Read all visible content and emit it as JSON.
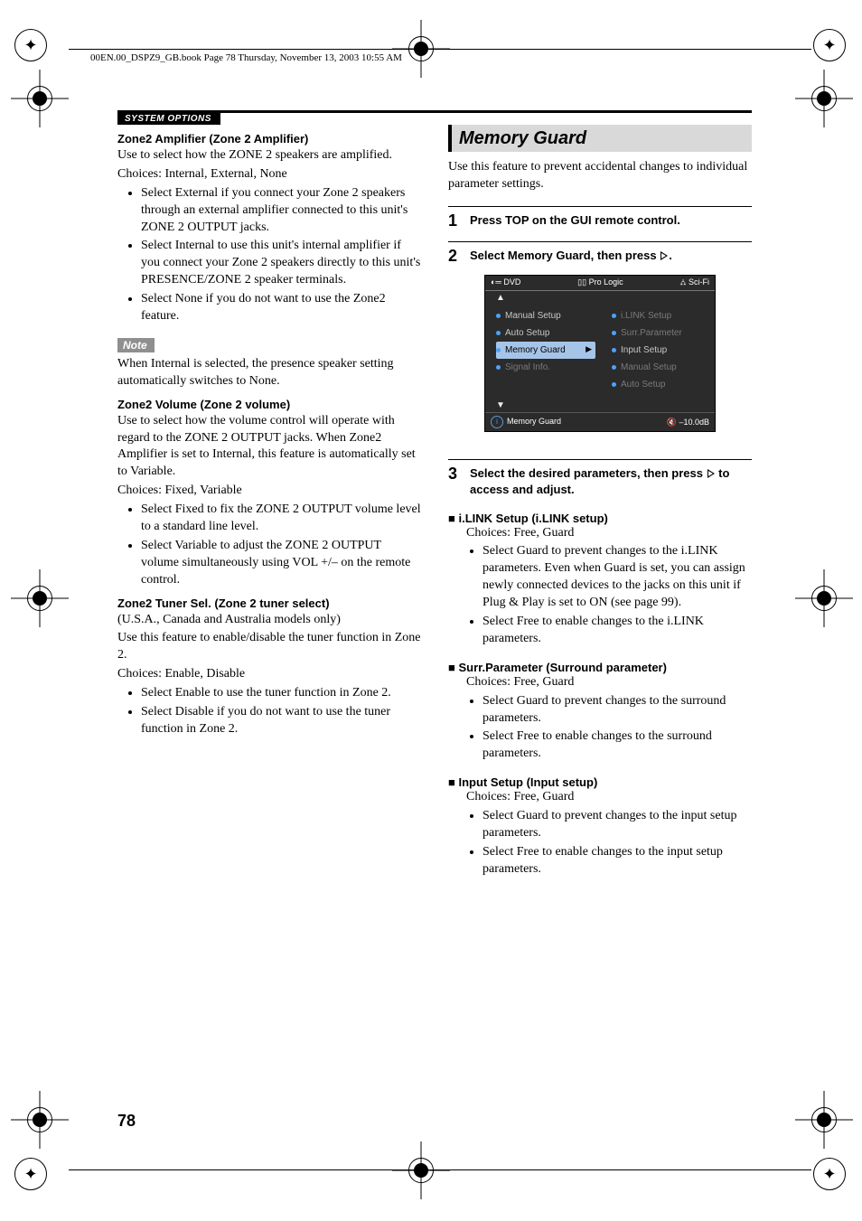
{
  "header_line": "00EN.00_DSPZ9_GB.book  Page 78  Thursday, November 13, 2003  10:55 AM",
  "section_label": "SYSTEM OPTIONS",
  "page_number": "78",
  "left": {
    "zone2amp": {
      "heading": "Zone2 Amplifier (Zone 2 Amplifier)",
      "p1": "Use to select how the ZONE 2 speakers are amplified.",
      "p2": "Choices: Internal, External, None",
      "b1": "Select External if you connect your Zone 2 speakers through an external amplifier connected to this unit's ZONE 2 OUTPUT jacks.",
      "b2": "Select Internal to use this unit's internal amplifier if you connect your Zone 2 speakers directly to this unit's PRESENCE/ZONE 2 speaker terminals.",
      "b3": "Select None if you do not want to use the Zone2 feature."
    },
    "note_label": "Note",
    "note_text": "When Internal is selected, the presence speaker setting automatically switches to None.",
    "zone2vol": {
      "heading": "Zone2 Volume (Zone 2 volume)",
      "p1": "Use to select how the volume control will operate with regard to the ZONE 2 OUTPUT jacks. When Zone2 Amplifier is set to Internal, this feature is automatically set to Variable.",
      "p2": "Choices: Fixed, Variable",
      "b1": "Select Fixed to fix the ZONE 2 OUTPUT volume level to a standard line level.",
      "b2": "Select Variable to adjust the ZONE 2 OUTPUT volume simultaneously using VOL +/– on the remote control."
    },
    "zone2tuner": {
      "heading": "Zone2 Tuner Sel. (Zone 2 tuner select)",
      "p0": "(U.S.A., Canada and Australia models only)",
      "p1": "Use this feature to enable/disable the tuner function in Zone 2.",
      "p2": "Choices: Enable, Disable",
      "b1": "Select Enable to use the tuner function in Zone 2.",
      "b2": "Select Disable if you do not want to use the tuner function in Zone 2."
    }
  },
  "right": {
    "title": "Memory Guard",
    "intro": "Use this feature to prevent accidental changes to individual parameter settings.",
    "step1": "Press TOP on the GUI remote control.",
    "step2_a": "Select Memory Guard, then press ",
    "step2_b": ".",
    "step3_a": "Select the desired parameters, then press ",
    "step3_b": " to access and adjust.",
    "gui": {
      "top_left": "DVD",
      "top_mid": "Pro Logic",
      "top_right": "Sci-Fi",
      "left_items": [
        "Manual Setup",
        "Auto Setup",
        "Memory Guard",
        "Signal Info."
      ],
      "right_items": [
        "i.LINK Setup",
        "Surr.Parameter",
        "Input Setup",
        "Manual Setup",
        "Auto Setup"
      ],
      "footer_label": "Memory Guard",
      "footer_vol": "–10.0dB"
    },
    "ilink": {
      "heading": " i.LINK Setup (i.LINK setup)",
      "choices": "Choices: Free, Guard",
      "b1": "Select Guard to prevent changes to the i.LINK parameters. Even when Guard is set, you can assign newly connected devices to the jacks on this unit if Plug & Play is set to ON (see page 99).",
      "b2": "Select Free to enable changes to the i.LINK parameters."
    },
    "surr": {
      "heading": "Surr.Parameter (Surround parameter)",
      "choices": "Choices: Free, Guard",
      "b1": "Select Guard to prevent changes to the surround parameters.",
      "b2": "Select Free to enable changes to the surround parameters."
    },
    "input": {
      "heading": "Input Setup (Input setup)",
      "choices": "Choices: Free, Guard",
      "b1": "Select Guard to prevent changes to the input setup parameters.",
      "b2": "Select Free to enable changes to the input setup parameters."
    }
  }
}
